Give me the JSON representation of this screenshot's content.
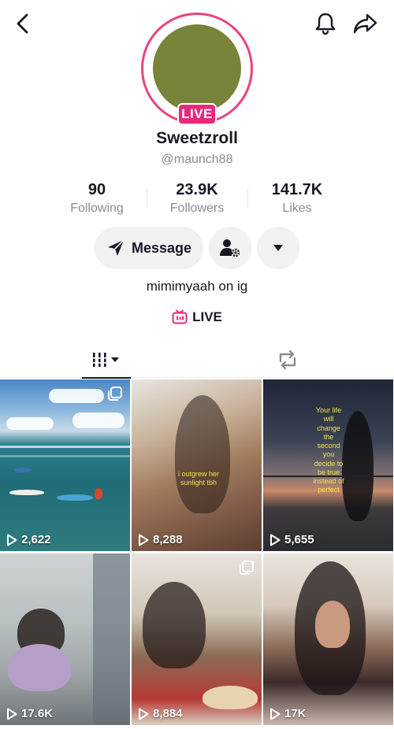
{
  "topbar": {
    "back_icon": "chevron-left-icon",
    "bell_icon": "bell-icon",
    "share_icon": "share-arrow-icon"
  },
  "profile": {
    "live_badge": "LIVE",
    "display_name": "Sweetzroll",
    "handle": "@maunch88",
    "ring_color": "#e8447a",
    "badge_color": "#e8287a"
  },
  "stats": {
    "following": {
      "value": "90",
      "label": "Following"
    },
    "followers": {
      "value": "23.9K",
      "label": "Followers"
    },
    "likes": {
      "value": "141.7K",
      "label": "Likes"
    }
  },
  "actions": {
    "message_label": "Message",
    "message_icon": "send-icon",
    "add_friend_icon": "person-settings-icon",
    "more_icon": "caret-down-icon"
  },
  "bio": "mimimyaah on ig",
  "live_link": {
    "icon": "live-tv-icon",
    "label": "LIVE"
  },
  "tabs": [
    {
      "name": "videos",
      "icon": "grid-bars-icon",
      "active": true
    },
    {
      "name": "reposts",
      "icon": "repost-icon",
      "active": false
    }
  ],
  "videos": [
    {
      "views": "2,622",
      "multi": true
    },
    {
      "views": "8,288",
      "multi": false,
      "overlay": "i outgrew her sunlight tbh"
    },
    {
      "views": "5,655",
      "multi": false,
      "overlay": "Your life will change the second you decide to be true instead of perfect"
    },
    {
      "views": "17.6K",
      "multi": false
    },
    {
      "views": "8,884",
      "multi": true
    },
    {
      "views": "17K",
      "multi": false
    }
  ]
}
